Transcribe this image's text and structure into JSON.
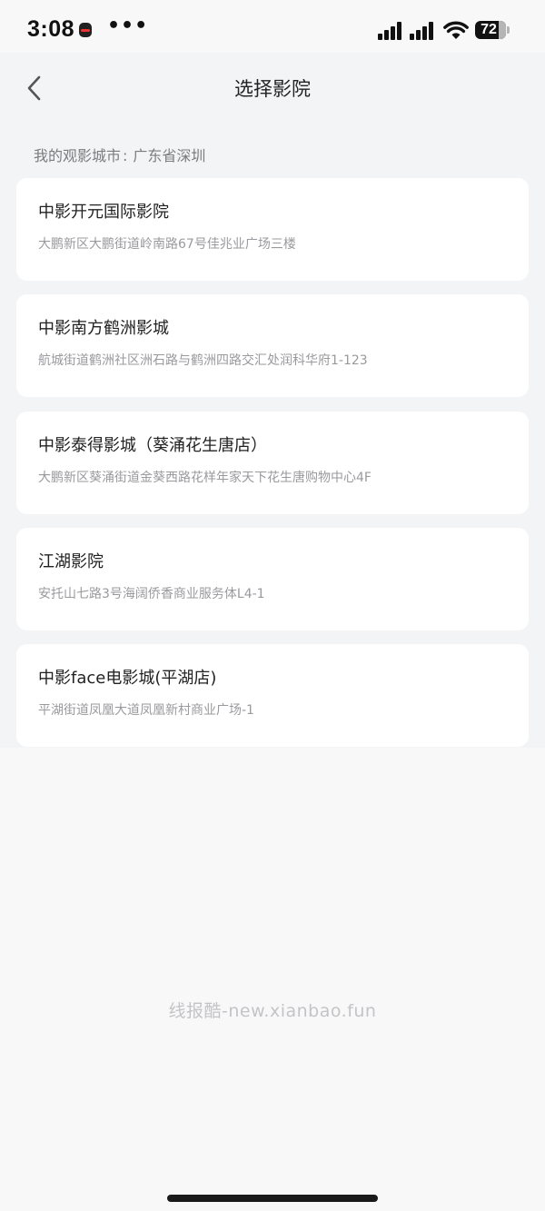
{
  "status_bar": {
    "time": "3:08",
    "more_dots": "•••",
    "battery_level": "72"
  },
  "header": {
    "title": "选择影院"
  },
  "city": {
    "label": "我的观影城市",
    "separator": ":",
    "value": "广东省深圳"
  },
  "cinemas": [
    {
      "name": "中影开元国际影院",
      "address": "大鹏新区大鹏街道岭南路67号佳兆业广场三楼"
    },
    {
      "name": "中影南方鹤洲影城",
      "address": "航城街道鹤洲社区洲石路与鹤洲四路交汇处润科华府1-123"
    },
    {
      "name": "中影泰得影城（葵涌花生唐店）",
      "address": "大鹏新区葵涌街道金葵西路花样年家天下花生唐购物中心4F"
    },
    {
      "name": "江湖影院",
      "address": "安托山七路3号海阔侨香商业服务体L4-1"
    },
    {
      "name": "中影face电影城(平湖店)",
      "address": "平湖街道凤凰大道凤凰新村商业广场-1"
    }
  ],
  "watermark": "线报酷-new.xianbao.fun",
  "colors": {
    "background": "#f3f4f6",
    "card": "#ffffff",
    "primary_text": "#222222",
    "secondary_text": "#9a9a9e"
  }
}
